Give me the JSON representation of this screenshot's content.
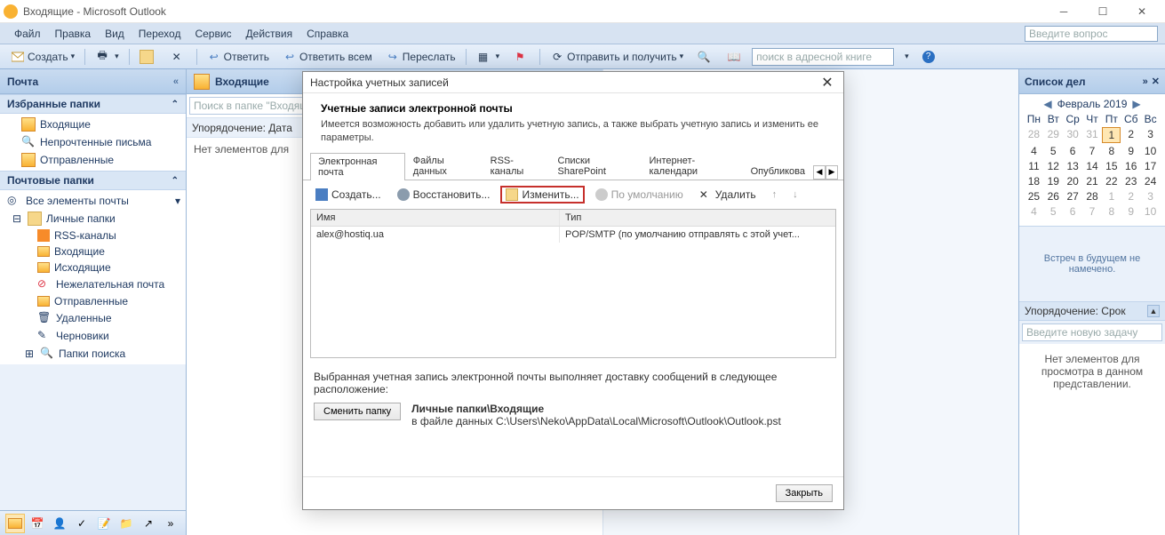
{
  "window": {
    "title": "Входящие - Microsoft Outlook"
  },
  "menu": {
    "items": [
      "Файл",
      "Правка",
      "Вид",
      "Переход",
      "Сервис",
      "Действия",
      "Справка"
    ],
    "question_placeholder": "Введите вопрос"
  },
  "toolbar": {
    "new": "Создать",
    "reply": "Ответить",
    "reply_all": "Ответить всем",
    "forward": "Переслать",
    "send_receive": "Отправить и получить",
    "search_placeholder": "поиск в адресной книге"
  },
  "nav": {
    "title": "Почта",
    "fav_header": "Избранные папки",
    "fav_items": [
      "Входящие",
      "Непрочтенные письма",
      "Отправленные"
    ],
    "mail_header": "Почтовые папки",
    "all_items": "Все элементы почты",
    "tree_root": "Личные папки",
    "tree_items": [
      "RSS-каналы",
      "Входящие",
      "Исходящие",
      "Нежелательная почта",
      "Отправленные",
      "Удаленные",
      "Черновики",
      "Папки поиска"
    ]
  },
  "list": {
    "title": "Входящие",
    "search_placeholder": "Поиск в папке \"Входящи",
    "sort_label": "Упорядочение: Дата",
    "empty_text": "Нет элементов для"
  },
  "todo": {
    "title": "Список дел",
    "month": "Февраль 2019",
    "dow": [
      "Пн",
      "Вт",
      "Ср",
      "Чт",
      "Пт",
      "Сб",
      "Вс"
    ],
    "prev_tail": [
      28,
      29,
      30,
      31
    ],
    "days": [
      1,
      2,
      3,
      4,
      5,
      6,
      7,
      8,
      9,
      10,
      11,
      12,
      13,
      14,
      15,
      16,
      17,
      18,
      19,
      20,
      21,
      22,
      23,
      24,
      25,
      26,
      27,
      28
    ],
    "next_head": [
      1,
      2,
      3,
      4,
      5,
      6,
      7,
      8,
      9,
      10
    ],
    "today": 1,
    "no_meetings": "Встреч в будущем не намечено.",
    "sort_label": "Упорядочение: Срок",
    "new_task_placeholder": "Введите новую задачу",
    "empty_text": "Нет элементов для просмотра в данном представлении."
  },
  "dialog": {
    "title": "Настройка учетных записей",
    "heading": "Учетные записи электронной почты",
    "desc": "Имеется возможность добавить или удалить учетную запись, а также выбрать учетную запись и изменить ее параметры.",
    "tabs": [
      "Электронная почта",
      "Файлы данных",
      "RSS-каналы",
      "Списки SharePoint",
      "Интернет-календари",
      "Опубликова"
    ],
    "tool": {
      "new": "Создать...",
      "repair": "Восстановить...",
      "edit": "Изменить...",
      "default": "По умолчанию",
      "delete": "Удалить"
    },
    "cols": {
      "name": "Имя",
      "type": "Тип"
    },
    "account": {
      "name": "alex@hostiq.ua",
      "type": "POP/SMTP (по умолчанию отправлять с этой учет..."
    },
    "deliver_label": "Выбранная учетная запись электронной почты выполняет доставку сообщений в следующее расположение:",
    "change_folder": "Сменить папку",
    "deliver_to": "Личные папки\\Входящие",
    "deliver_file": "в файле данных C:\\Users\\Neko\\AppData\\Local\\Microsoft\\Outlook\\Outlook.pst",
    "close": "Закрыть"
  }
}
